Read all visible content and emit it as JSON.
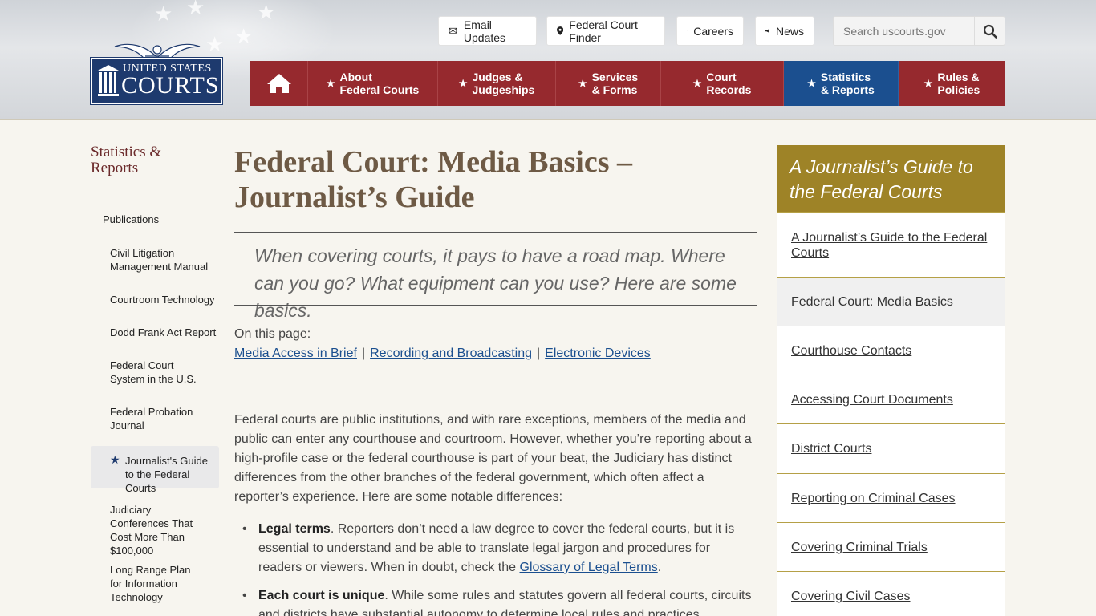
{
  "header": {
    "logo_line1": "UNITED STATES",
    "logo_line2": "COURTS",
    "util": {
      "email": "Email Updates",
      "finder": "Federal Court Finder",
      "careers": "Careers",
      "news": "News"
    },
    "search_placeholder": "Search uscourts.gov"
  },
  "nav": {
    "about_1": "About",
    "about_2": "Federal Courts",
    "judges_1": "Judges &",
    "judges_2": "Judgeships",
    "services_1": "Services",
    "services_2": "& Forms",
    "records_1": "Court",
    "records_2": "Records",
    "stats_1": "Statistics",
    "stats_2": "& Reports",
    "rules_1": "Rules &",
    "rules_2": "Policies"
  },
  "sidebar": {
    "title_1": "Statistics &",
    "title_2": "Reports",
    "publications": "Publications",
    "items": [
      "Civil Litigation Management Manual",
      "Courtroom Technology",
      "Dodd Frank Act Report",
      "Federal Court System in the U.S.",
      "Federal Probation Journal",
      "Journalist's Guide to the Federal Courts",
      "Judiciary Conferences That Cost More Than $100,000",
      "Long Range Plan for Information Technology"
    ]
  },
  "main": {
    "title": "Federal Court: Media Basics – Journalist’s Guide",
    "lede": "When covering courts, it pays to have a road map. Where can you go? What equipment can you use? Here are some basics.",
    "on_this_page": "On this page:",
    "links": [
      "Media Access in Brief",
      "Recording and Broadcasting",
      "Electronic Devices"
    ],
    "intro": "Federal courts are public institutions, and with rare exceptions, members of the media and public can enter any courthouse and courtroom. However, whether you’re reporting about a high-profile case or the federal courthouse is part of your beat, the Judiciary has distinct differences from the other branches of the federal government, which often affect a reporter’s experience. Here are some notable differences:",
    "bullet1_bold": "Legal terms",
    "bullet1_text": ". Reporters don’t need a law degree to cover the federal courts, but it is essential to understand and be able to translate legal jargon and procedures for readers or viewers. When in doubt, check the ",
    "bullet1_link": "Glossary of Legal Terms",
    "bullet1_end": ".",
    "bullet2_bold": "Each court is unique",
    "bullet2_text": ". While some rules and statutes govern all federal courts, circuits and districts have substantial autonomy to determine local rules and practices."
  },
  "right": {
    "heading": "A Journalist’s Guide to the Federal Courts",
    "items": [
      "A Journalist’s Guide to the Federal Courts",
      "Federal Court: Media Basics",
      "Courthouse Contacts",
      "Accessing Court Documents",
      "District Courts",
      "Reporting on Criminal Cases",
      "Covering Criminal Trials",
      "Covering Civil Cases"
    ]
  },
  "colors": {
    "nav_red": "#96292e",
    "nav_active_blue": "#1b4f8f",
    "gold": "#9e8327",
    "link_blue": "#1b4f8f"
  }
}
